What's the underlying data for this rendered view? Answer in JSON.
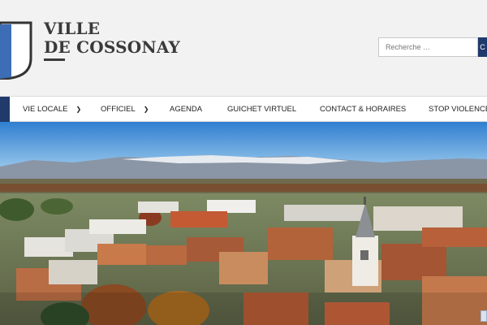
{
  "header": {
    "brand_line1": "VILLE",
    "brand_line2": "DE COSSONAY",
    "logo_icon": "coat-of-arms-icon",
    "search": {
      "placeholder": "Recherche …",
      "button_label": "C"
    }
  },
  "nav": {
    "items": [
      {
        "label": "VIE LOCALE",
        "has_dropdown": true
      },
      {
        "label": "OFFICIEL",
        "has_dropdown": true
      },
      {
        "label": "AGENDA",
        "has_dropdown": false
      },
      {
        "label": "GUICHET VIRTUEL",
        "has_dropdown": false
      },
      {
        "label": "CONTACT & HORAIRES",
        "has_dropdown": false
      },
      {
        "label": "STOP VIOLENCE",
        "has_dropdown": false
      }
    ],
    "dropdown_icon": "chevron-down-icon"
  },
  "hero": {
    "image": "aerial-town-photo"
  },
  "colors": {
    "accent": "#1f3a6b",
    "brand_text": "#3a3a3a",
    "shield_blue": "#3d6db5",
    "header_bg": "#f2f2f2"
  }
}
